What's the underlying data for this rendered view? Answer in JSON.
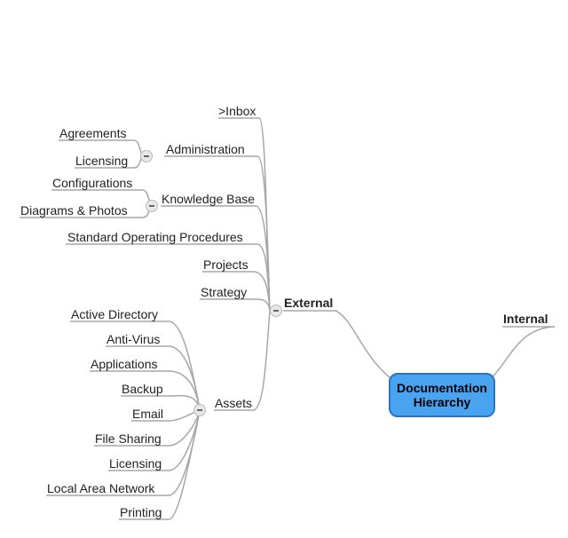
{
  "root": {
    "line1": "Documentation",
    "line2": "Hierarchy"
  },
  "internal": {
    "label": "Internal"
  },
  "external": {
    "label": "External",
    "children": {
      "inbox": ">Inbox",
      "administration": "Administration",
      "knowledge_base": "Knowledge Base",
      "sop": "Standard Operating Procedures",
      "projects": "Projects",
      "strategy": "Strategy",
      "assets": "Assets"
    }
  },
  "administration_children": {
    "agreements": "Agreements",
    "licensing": "Licensing"
  },
  "knowledge_base_children": {
    "configurations": "Configurations",
    "diagrams_photos": "Diagrams & Photos"
  },
  "assets_children": {
    "active_directory": "Active Directory",
    "anti_virus": "Anti-Virus",
    "applications": "Applications",
    "backup": "Backup",
    "email": "Email",
    "file_sharing": "File Sharing",
    "licensing": "Licensing",
    "lan": "Local Area Network",
    "printing": "Printing"
  }
}
